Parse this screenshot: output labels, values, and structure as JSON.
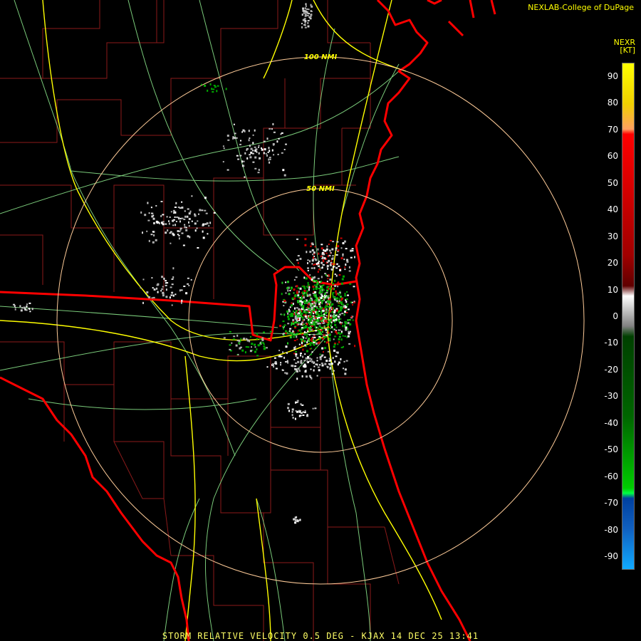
{
  "header": {
    "credit": "NEXLAB-College of DuPage",
    "credit_color": "#ffff00"
  },
  "legend": {
    "product": "NEXR",
    "unit": "[KT]",
    "ticks": [
      "90",
      "80",
      "70",
      "60",
      "50",
      "40",
      "30",
      "20",
      "10",
      "0",
      "-10",
      "-20",
      "-30",
      "-40",
      "-50",
      "-60",
      "-70",
      "-80",
      "-90"
    ],
    "range": [
      -95,
      95
    ]
  },
  "map": {
    "radar_site": "KJAX",
    "range_rings": [
      {
        "label": "50 NMI"
      },
      {
        "label": "100 NMI"
      }
    ],
    "colors": {
      "coastline": "#ff0000",
      "counties": "#8b1a1a",
      "roads": "#90ee90",
      "interstates": "#ffff00",
      "rings": "#ffcc99",
      "echo_inbound": "#00aa00",
      "echo_outbound": "#cc0000",
      "echo_zero": "#b0b0b0"
    }
  },
  "footer": {
    "caption": "STORM RELATIVE VELOCITY 0.5 DEG - KJAX 14 DEC 25 13:41",
    "color": "#ffff66"
  }
}
